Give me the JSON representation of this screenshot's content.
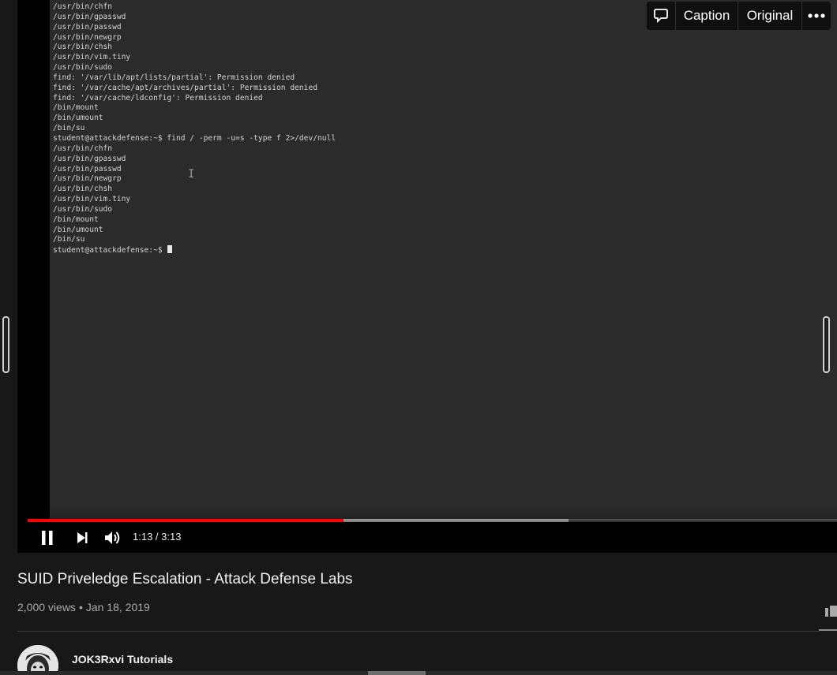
{
  "video": {
    "terminal_lines": [
      "/usr/bin/chfn",
      "/usr/bin/gpasswd",
      "/usr/bin/passwd",
      "/usr/bin/newgrp",
      "/usr/bin/chsh",
      "/usr/bin/vim.tiny",
      "/usr/bin/sudo",
      "find: '/var/lib/apt/lists/partial': Permission denied",
      "find: '/var/cache/apt/archives/partial': Permission denied",
      "find: '/var/cache/ldconfig': Permission denied",
      "/bin/mount",
      "/bin/umount",
      "/bin/su",
      "student@attackdefense:~$ find / -perm -u=s -type f 2>/dev/null",
      "/usr/bin/chfn",
      "/usr/bin/gpasswd",
      "/usr/bin/passwd",
      "/usr/bin/newgrp",
      "/usr/bin/chsh",
      "/usr/bin/vim.tiny",
      "/usr/bin/sudo",
      "/bin/mount",
      "/bin/umount",
      "/bin/su"
    ],
    "prompt": "student@attackdefense:~$ ",
    "ibeam_glyph": "I"
  },
  "player": {
    "time_display": "1:13 / 3:13",
    "progress_fraction": 0.39,
    "buffered_fraction": 0.668,
    "progress_color": "#ff0000",
    "pause_icon": "pause-icon",
    "next_icon": "next-icon",
    "volume_icon": "volume-icon"
  },
  "overlay_toolbar": {
    "comment_icon": "comment-icon",
    "caption_label": "Caption",
    "original_label": "Original",
    "more_icon": "more-icon"
  },
  "info": {
    "title": "SUID Priveledge Escalation - Attack Defense Labs",
    "views": "2,000 views",
    "separator": "•",
    "date": "Jan 18, 2019",
    "channel_name": "JOK3Rxvi Tutorials"
  }
}
